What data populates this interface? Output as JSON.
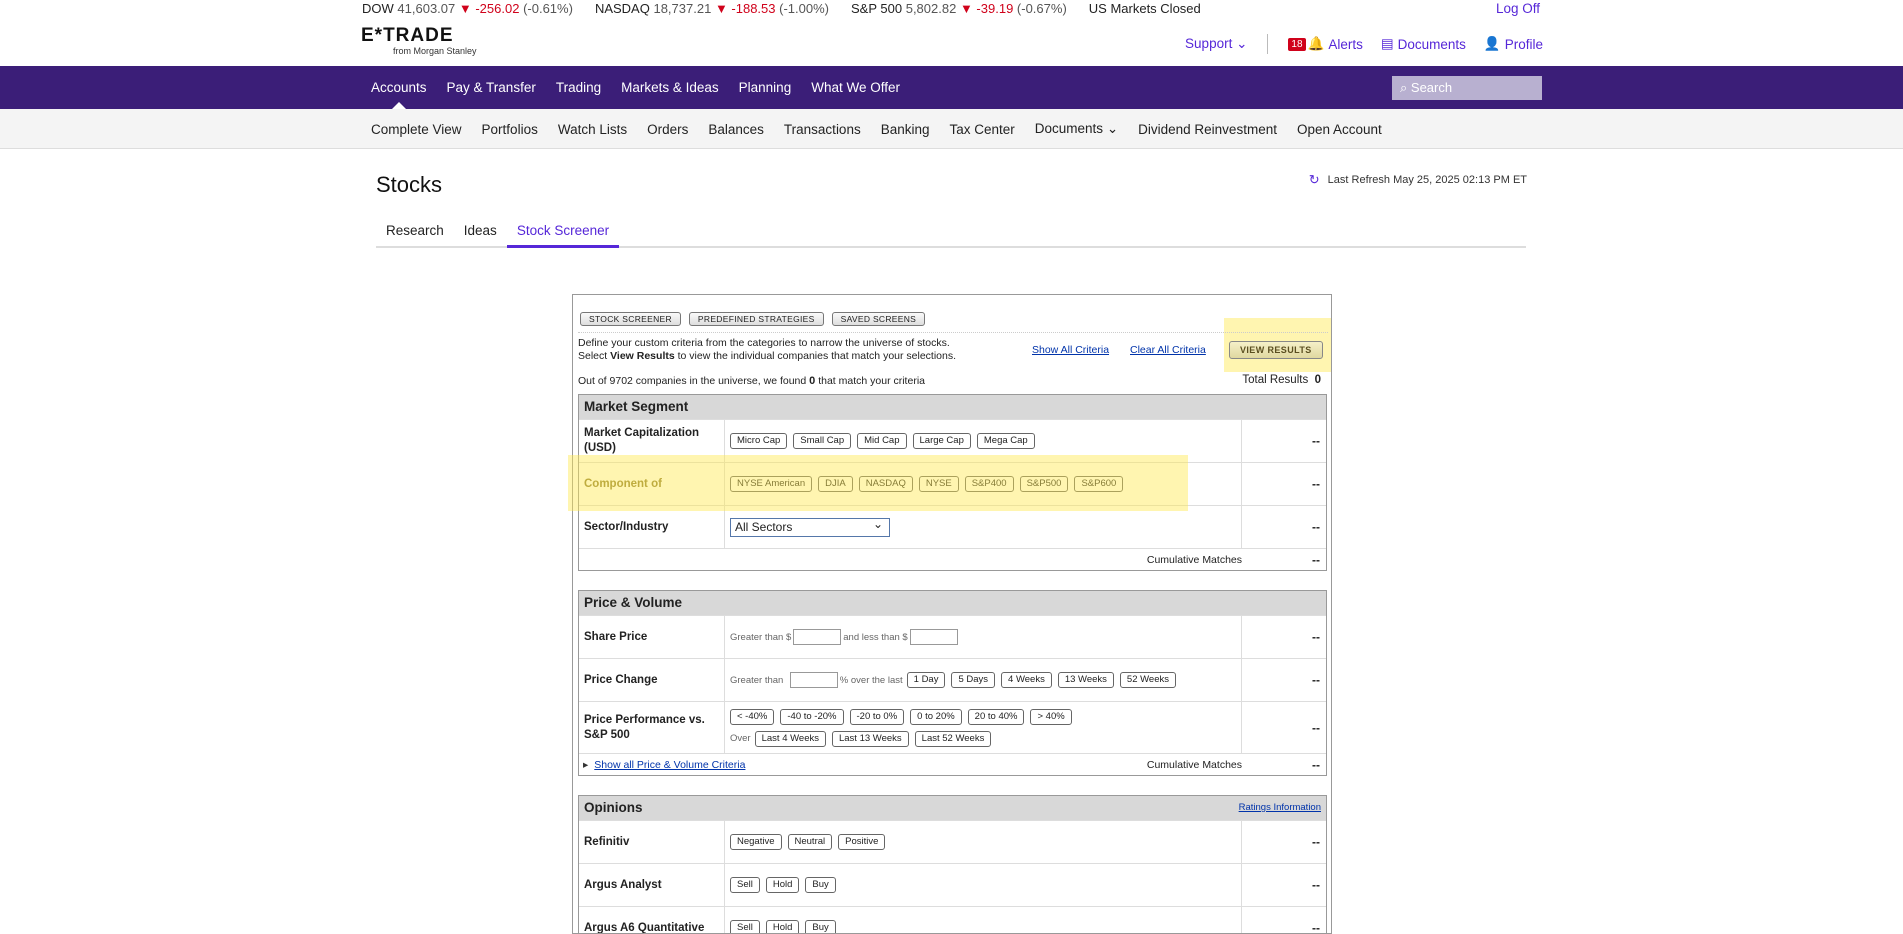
{
  "ticker": {
    "dow": {
      "name": "DOW",
      "value": "41,603.07",
      "change": "▼ -256.02",
      "pct": "(-0.61%)"
    },
    "nasdaq": {
      "name": "NASDAQ",
      "value": "18,737.21",
      "change": "▼ -188.53",
      "pct": "(-1.00%)"
    },
    "sp500": {
      "name": "S&P 500",
      "value": "5,802.82",
      "change": "▼ -39.19",
      "pct": "(-0.67%)"
    },
    "status": "US Markets Closed",
    "logoff": "Log Off"
  },
  "header": {
    "brand": "E*TRADE",
    "brand_sub": "from Morgan Stanley",
    "support": "Support",
    "alerts_count": "18",
    "alerts": "Alerts",
    "documents": "Documents",
    "profile": "Profile"
  },
  "nav": [
    "Accounts",
    "Pay & Transfer",
    "Trading",
    "Markets & Ideas",
    "Planning",
    "What We Offer"
  ],
  "search_placeholder": "Search",
  "subnav": [
    "Complete View",
    "Portfolios",
    "Watch Lists",
    "Orders",
    "Balances",
    "Transactions",
    "Banking",
    "Tax Center",
    "Documents",
    "Dividend Reinvestment",
    "Open Account"
  ],
  "page": {
    "title": "Stocks",
    "last_refresh": "Last Refresh May 25, 2025 02:13 PM ET"
  },
  "tabs": [
    "Research",
    "Ideas",
    "Stock Screener"
  ],
  "screener": {
    "top_buttons": [
      "STOCK SCREENER",
      "PREDEFINED STRATEGIES",
      "SAVED SCREENS"
    ],
    "desc1": "Define your custom criteria from the categories to narrow the universe of stocks.",
    "desc2_pre": "Select ",
    "desc2_bold": "View Results",
    "desc2_post": " to view the individual companies that match your selections.",
    "show_all": "Show All Criteria",
    "clear_all": "Clear All Criteria",
    "view_results": "VIEW RESULTS",
    "outof_pre": "Out of 9702 companies in the universe, we found ",
    "outof_count": "0",
    "outof_post": " that match your criteria",
    "total_label": "Total Results",
    "total_value": "0",
    "dash": "--",
    "market_segment": {
      "title": "Market Segment",
      "mcap_label": "Market Capitalization (USD)",
      "mcap": [
        "Micro Cap",
        "Small Cap",
        "Mid Cap",
        "Large Cap",
        "Mega Cap"
      ],
      "comp_label": "Component of",
      "comp": [
        "NYSE American",
        "DJIA",
        "NASDAQ",
        "NYSE",
        "S&P400",
        "S&P500",
        "S&P600"
      ],
      "sector_label": "Sector/Industry",
      "sector_value": "All Sectors",
      "cum": "Cumulative Matches"
    },
    "price_volume": {
      "title": "Price & Volume",
      "share_label": "Share Price",
      "gt": "Greater than $",
      "lt": "and less than $",
      "change_label": "Price Change",
      "gt2": "Greater than",
      "overlast": "% over the last",
      "periods": [
        "1 Day",
        "5 Days",
        "4 Weeks",
        "13 Weeks",
        "52 Weeks"
      ],
      "perf_label": "Price Performance vs. S&P 500",
      "ranges": [
        "< -40%",
        "-40 to -20%",
        "-20 to 0%",
        "0 to 20%",
        "20 to 40%",
        "> 40%"
      ],
      "over": "Over",
      "over_periods": [
        "Last 4 Weeks",
        "Last 13 Weeks",
        "Last 52 Weeks"
      ],
      "show_all": "Show all Price & Volume Criteria",
      "cum": "Cumulative Matches"
    },
    "opinions": {
      "title": "Opinions",
      "ratings": "Ratings Information",
      "refinitiv": "Refinitiv",
      "ref_opts": [
        "Negative",
        "Neutral",
        "Positive"
      ],
      "argus": "Argus Analyst",
      "argus_opts": [
        "Sell",
        "Hold",
        "Buy"
      ],
      "argus6": "Argus A6 Quantitative",
      "argus6_opts": [
        "Sell",
        "Hold",
        "Buy"
      ]
    }
  },
  "colors": {
    "accent": "#5627d8",
    "nav_bg": "#3b1e78",
    "negative": "#d0021b",
    "highlight": "#ffe850"
  }
}
